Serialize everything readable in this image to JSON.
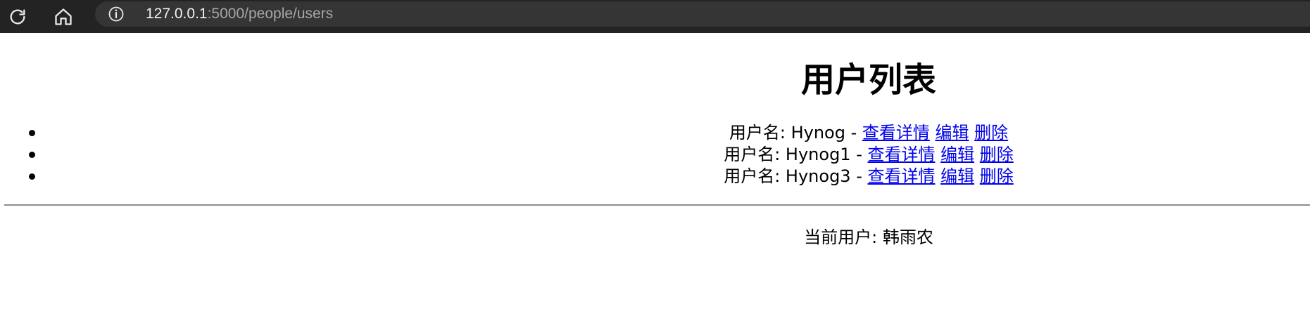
{
  "browser": {
    "url_host": "127.0.0.1",
    "url_path": ":5000/people/users",
    "icons": {
      "reload": "reload-icon",
      "home": "home-icon",
      "info": "info-icon"
    }
  },
  "page": {
    "title": "用户列表",
    "users": [
      {
        "prefix": "用户名: ",
        "name": "Hynog",
        "separator": " - ",
        "view_label": "查看详情",
        "edit_label": "编辑",
        "delete_label": "删除"
      },
      {
        "prefix": "用户名: ",
        "name": "Hynog1",
        "separator": " - ",
        "view_label": "查看详情",
        "edit_label": "编辑",
        "delete_label": "删除"
      },
      {
        "prefix": "用户名: ",
        "name": "Hynog3",
        "separator": " - ",
        "view_label": "查看详情",
        "edit_label": "编辑",
        "delete_label": "删除"
      }
    ],
    "current_user_label": "当前用户: ",
    "current_user_name": "韩雨农"
  },
  "colors": {
    "link": "#0000ee",
    "toolbar": "#232323",
    "address_bar": "#353535"
  }
}
